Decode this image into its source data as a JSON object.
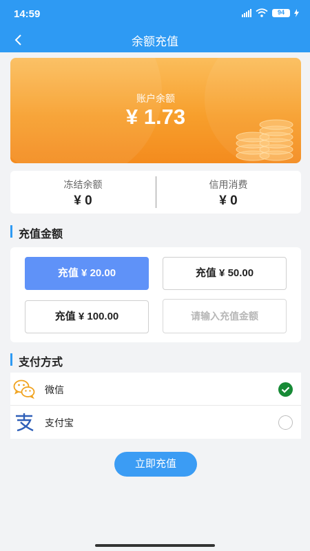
{
  "status_bar": {
    "time": "14:59",
    "battery": "94"
  },
  "nav": {
    "title": "余额充值"
  },
  "balance_card": {
    "label": "账户余额",
    "value": "¥ 1.73"
  },
  "sub_balances": [
    {
      "label": "冻结余额",
      "value": "¥ 0"
    },
    {
      "label": "信用消费",
      "value": "¥ 0"
    }
  ],
  "recharge": {
    "section_title": "充值金额",
    "options": [
      "充值 ¥ 20.00",
      "充值 ¥ 50.00",
      "充值 ¥ 100.00"
    ],
    "selected_index": 0,
    "custom_placeholder": "请输入充值金额"
  },
  "payment": {
    "section_title": "支付方式",
    "methods": [
      {
        "label": "微信",
        "icon": "wechat-icon",
        "selected": true
      },
      {
        "label": "支付宝",
        "icon": "alipay-icon",
        "selected": false
      }
    ]
  },
  "submit": {
    "label": "立即充值"
  },
  "colors": {
    "primary": "#2e9af3",
    "selected_option": "#5f92f8",
    "card_orange": "#f79f2c",
    "check_green": "#178a36"
  }
}
